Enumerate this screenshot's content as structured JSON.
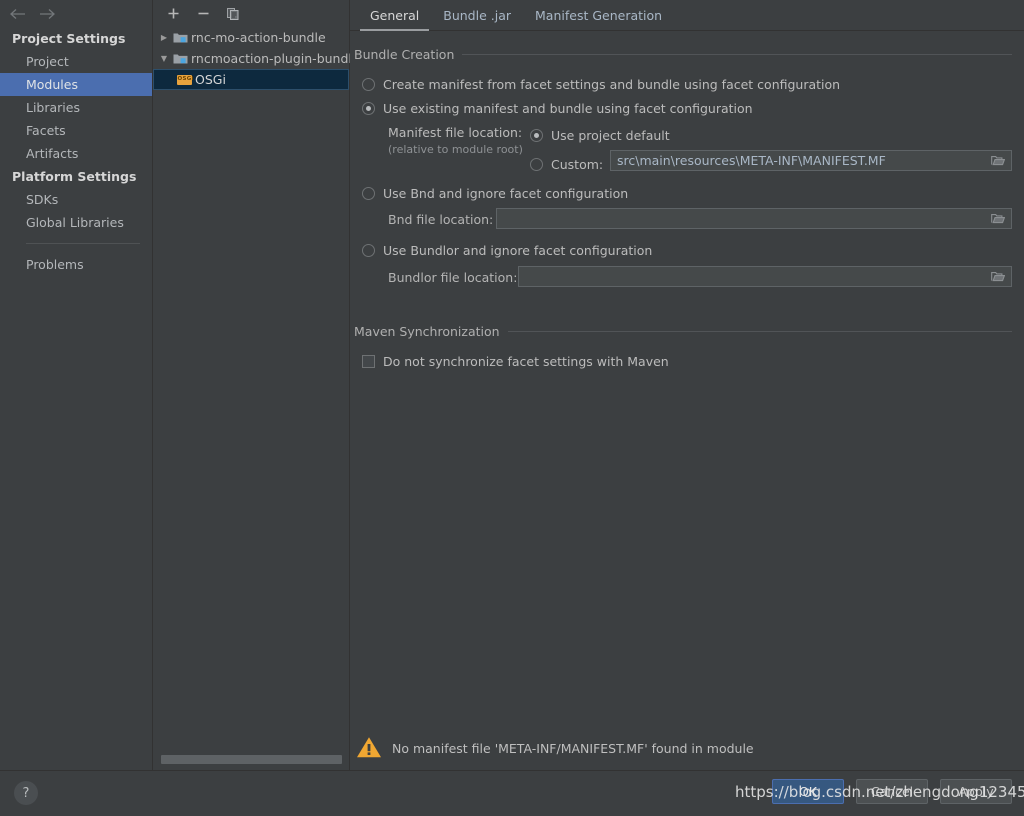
{
  "window": {
    "theme_bg": "#3c3f41",
    "accent": "#4b6eaf",
    "selection_tree": "#0d293e",
    "warning_color": "#e8a33d"
  },
  "nav": {
    "back_icon": "arrow-left-icon",
    "forward_icon": "arrow-right-icon"
  },
  "sidebar": {
    "sections": [
      {
        "title": "Project Settings",
        "items": [
          {
            "label": "Project",
            "selected": false
          },
          {
            "label": "Modules",
            "selected": true
          },
          {
            "label": "Libraries",
            "selected": false
          },
          {
            "label": "Facets",
            "selected": false
          },
          {
            "label": "Artifacts",
            "selected": false
          }
        ]
      },
      {
        "title": "Platform Settings",
        "items": [
          {
            "label": "SDKs",
            "selected": false
          },
          {
            "label": "Global Libraries",
            "selected": false
          }
        ]
      }
    ],
    "problems_label": "Problems"
  },
  "tree_panel": {
    "toolbar": {
      "add_label": "+",
      "remove_label": "−",
      "copy_icon": "copy-icon"
    },
    "nodes": [
      {
        "label": "rnc-mo-action-bundle",
        "expanded": false,
        "level": 0,
        "icon": "module-folder-icon",
        "selected": false
      },
      {
        "label": "rncmoaction-plugin-bundle",
        "expanded": true,
        "level": 0,
        "icon": "module-folder-icon",
        "selected": false
      },
      {
        "label": "OSGi",
        "expanded": null,
        "level": 1,
        "icon": "osgi-badge-icon",
        "badge_text": "OSGi",
        "selected": true
      }
    ]
  },
  "content": {
    "tabs": [
      {
        "label": "General",
        "active": true
      },
      {
        "label": "Bundle .jar",
        "active": false
      },
      {
        "label": "Manifest Generation",
        "active": false
      }
    ],
    "bundle_creation": {
      "group_label": "Bundle Creation",
      "option_create_manifest": {
        "label": "Create manifest from facet settings and bundle using facet configuration",
        "selected": false
      },
      "option_use_existing": {
        "label": "Use existing manifest and bundle using facet configuration",
        "selected": true
      },
      "manifest_location": {
        "label": "Manifest file location:",
        "note": "(relative to module root)",
        "use_project_default": {
          "label": "Use project default",
          "selected": true
        },
        "custom": {
          "label": "Custom:",
          "selected": false
        },
        "custom_value": "src\\main\\resources\\META-INF\\MANIFEST.MF",
        "browse_icon": "folder-open-icon"
      },
      "option_use_bnd": {
        "label": "Use Bnd and ignore facet configuration",
        "selected": false
      },
      "bnd_location": {
        "label": "Bnd file location:",
        "value": "",
        "browse_icon": "folder-open-icon"
      },
      "option_use_bundlor": {
        "label": "Use Bundlor and ignore facet configuration",
        "selected": false
      },
      "bundlor_location": {
        "label": "Bundlor file location:",
        "value": "",
        "browse_icon": "folder-open-icon"
      }
    },
    "maven_sync": {
      "group_label": "Maven Synchronization",
      "do_not_sync": {
        "label": "Do not synchronize facet settings with Maven",
        "checked": false
      }
    },
    "warning": {
      "icon": "warning-triangle-icon",
      "text": "No manifest file 'META-INF/MANIFEST.MF' found in module"
    }
  },
  "bottom": {
    "help_label": "?",
    "buttons": [
      {
        "label": "OK",
        "primary": true
      },
      {
        "label": "Cancel",
        "primary": false
      },
      {
        "label": "Apply",
        "primary": false
      }
    ]
  },
  "watermark": {
    "text": "https://blog.csdn.net/zhengdong12345"
  }
}
